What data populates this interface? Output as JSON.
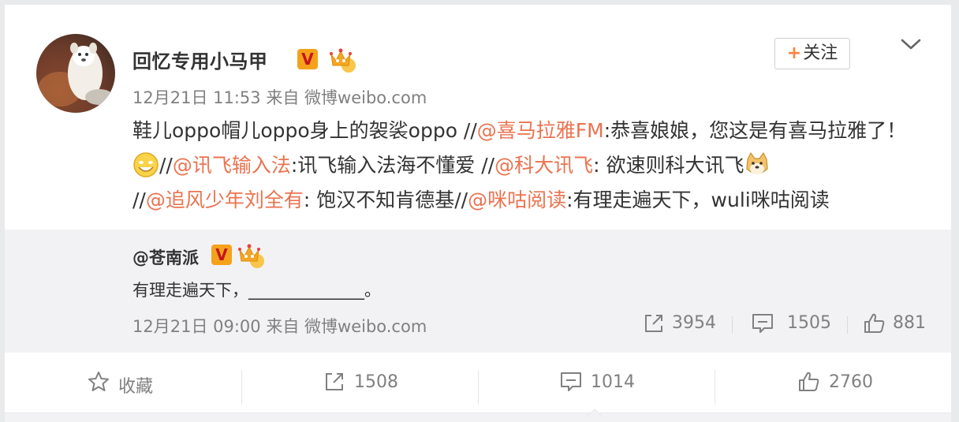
{
  "post": {
    "username": "回忆专用小马甲",
    "verified_badge": "V",
    "follow_label": "关注",
    "follow_plus": "+",
    "time": "12月21日 11:53",
    "source_prefix": "来自",
    "source": "微博weibo.com",
    "text": {
      "seg1": "鞋儿oppo帽儿oppo身上的袈裟oppo //",
      "m1": "@喜马拉雅FM",
      "seg2": ":恭喜娘娘，您这是有喜马拉雅了！",
      "seg3": "//",
      "m2": "@讯飞输入法",
      "seg4": ":讯飞输入法海不懂爱 //",
      "m3": "@科大讯飞",
      "seg5": ": 欲速则科大讯飞",
      "seg6": "//",
      "m4": "@追风少年刘全有",
      "seg7": ": 饱汉不知肯德基//",
      "m5": "@咪咕阅读",
      "seg8": ":有理走遍天下，wuli咪咕阅读"
    }
  },
  "quote": {
    "username": "@苍南派",
    "verified_badge": "V",
    "text": "有理走遍天下，______________。",
    "time": "12月21日 09:00",
    "source_prefix": "来自",
    "source": "微博weibo.com",
    "reposts": "3954",
    "comments": "1505",
    "likes": "881"
  },
  "actions": {
    "favorite_label": "收藏",
    "reposts": "1508",
    "comments": "1014",
    "likes": "2760"
  },
  "colors": {
    "mention": "#eb7350",
    "accent_orange": "#ff8140",
    "muted": "#808080"
  },
  "icons": [
    "chevron-down-icon",
    "crown-icon",
    "smile-emoji-icon",
    "doge-emoji-icon",
    "repost-icon",
    "comment-icon",
    "like-icon",
    "star-icon"
  ]
}
